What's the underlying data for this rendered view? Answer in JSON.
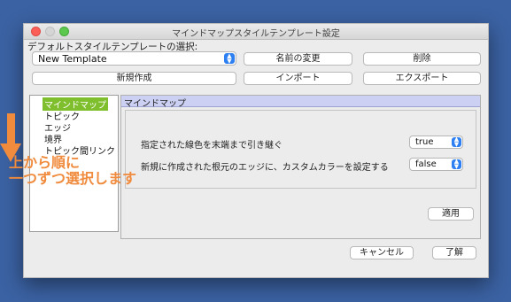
{
  "window": {
    "title": "マインドマップスタイルテンプレート設定"
  },
  "template_select": {
    "label": "デフォルトスタイルテンプレートの選択:",
    "value": "New Template"
  },
  "buttons": {
    "rename": "名前の変更",
    "delete": "削除",
    "new": "新規作成",
    "import": "インポート",
    "export": "エクスポート",
    "apply": "適用",
    "cancel": "キャンセル",
    "ok": "了解"
  },
  "tree": {
    "items": [
      {
        "label": "マインドマップ",
        "selected": true
      },
      {
        "label": "トピック",
        "selected": false
      },
      {
        "label": "エッジ",
        "selected": false
      },
      {
        "label": "境界",
        "selected": false
      },
      {
        "label": "トピック間リンク",
        "selected": false
      }
    ]
  },
  "panel": {
    "header": "マインドマップ",
    "options": [
      {
        "label": "指定された線色を末端まで引き継ぐ",
        "value": "true"
      },
      {
        "label": "新規に作成された根元のエッジに、カスタムカラーを設定する",
        "value": "false"
      }
    ]
  },
  "annotation": {
    "line1": "上から順に",
    "line2": "一つずつ選択します"
  },
  "colors": {
    "background": "#3b62a3",
    "selected_item": "#7fbf2e",
    "panel_header": "#ccd0f2",
    "annotation": "#f08a3c",
    "select_arrow": "#2e80f2"
  }
}
